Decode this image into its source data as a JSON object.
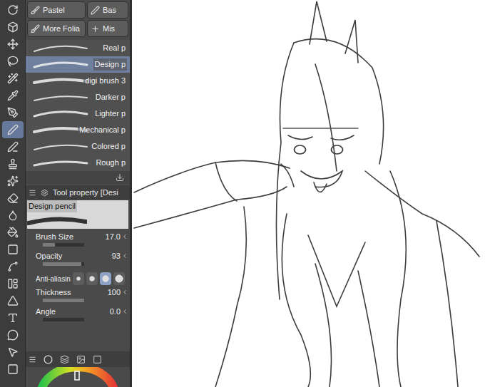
{
  "toolbar": {
    "tools": [
      {
        "kind": "rotate",
        "selected": false
      },
      {
        "kind": "cube",
        "selected": false
      },
      {
        "kind": "move",
        "selected": false
      },
      {
        "kind": "lasso",
        "selected": false
      },
      {
        "kind": "wand",
        "selected": false
      },
      {
        "kind": "eyedropper",
        "selected": false
      },
      {
        "kind": "pen",
        "selected": false
      },
      {
        "kind": "pencil",
        "selected": true
      },
      {
        "kind": "brush",
        "selected": false
      },
      {
        "kind": "stamp",
        "selected": false
      },
      {
        "kind": "sparkles",
        "selected": false
      },
      {
        "kind": "eraser",
        "selected": false
      },
      {
        "kind": "blend",
        "selected": false
      },
      {
        "kind": "fill",
        "selected": false
      },
      {
        "kind": "gradient",
        "selected": false
      },
      {
        "kind": "curve",
        "selected": false
      },
      {
        "kind": "frame",
        "selected": false
      },
      {
        "kind": "ruler",
        "selected": false
      },
      {
        "kind": "text",
        "selected": false
      },
      {
        "kind": "balloon",
        "selected": false
      },
      {
        "kind": "select",
        "selected": false
      },
      {
        "kind": "color",
        "selected": false
      }
    ]
  },
  "brush_groups": [
    {
      "label": "Pastel",
      "selected": false
    },
    {
      "label": "Bas",
      "selected": false
    },
    {
      "label": "More Folia",
      "selected": false
    },
    {
      "label": "Mis",
      "selected": false
    }
  ],
  "brushes": [
    {
      "label": "Real p",
      "selected": false
    },
    {
      "label": "Design p",
      "selected": true
    },
    {
      "label": "digi brush 3",
      "selected": false
    },
    {
      "label": "Darker p",
      "selected": false
    },
    {
      "label": "Lighter p",
      "selected": false
    },
    {
      "label": "Mechanical p",
      "selected": false
    },
    {
      "label": "Colored p",
      "selected": false
    },
    {
      "label": "Rough p",
      "selected": false
    }
  ],
  "tool_property": {
    "title": "Tool property [Desi",
    "preview_label": "Design pencil",
    "properties": [
      {
        "label": "Brush Size",
        "value": "17.0",
        "level": 0.3
      },
      {
        "label": "Opacity",
        "value": "93",
        "level": 0.93
      }
    ],
    "anti_aliasing": {
      "label": "Anti-aliasin",
      "options": [
        {
          "selected": false
        },
        {
          "selected": false
        },
        {
          "selected": true
        },
        {
          "selected": false
        }
      ]
    },
    "properties_lower": [
      {
        "label": "Thickness",
        "value": "100",
        "level": 1.0
      },
      {
        "label": "Angle",
        "value": "0.0",
        "level": 0.0
      }
    ]
  }
}
